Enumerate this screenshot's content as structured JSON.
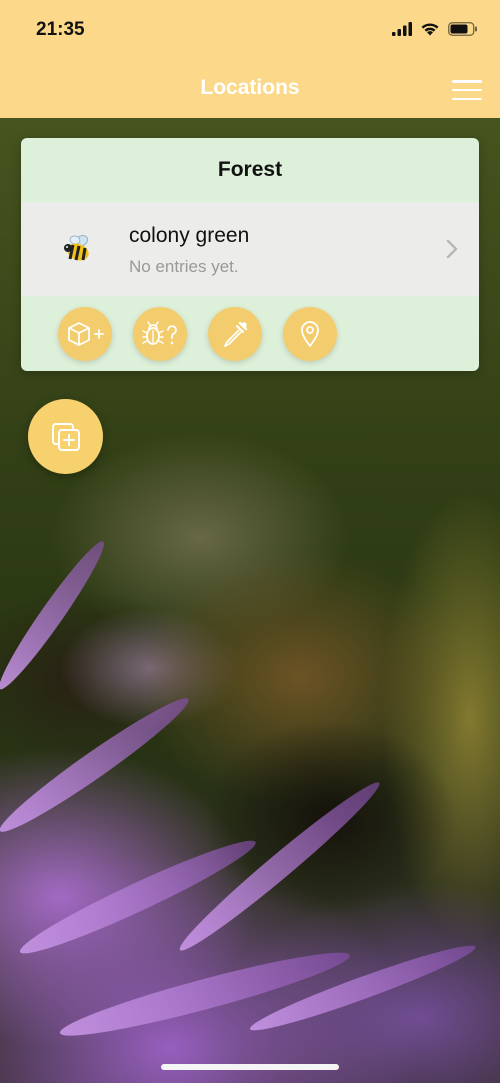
{
  "status_bar": {
    "time": "21:35",
    "icons": [
      "cellular-signal-icon",
      "wifi-icon",
      "battery-icon"
    ]
  },
  "nav": {
    "title": "Locations",
    "menu_icon": "hamburger-menu-icon"
  },
  "location_card": {
    "title": "Forest",
    "colony": {
      "icon": "bee-icon",
      "name": "colony green",
      "subtitle": "No entries yet."
    },
    "actions": [
      {
        "icon": "add-box-icon"
      },
      {
        "icon": "bug-question-icon"
      },
      {
        "icon": "pipette-icon"
      },
      {
        "icon": "location-pin-icon"
      }
    ]
  },
  "fab": {
    "icon": "add-copy-icon"
  },
  "colors": {
    "header": "#fcd98a",
    "title_text": "#ffffff",
    "card_bg": "#ddf0d9",
    "row_bg": "#ececea",
    "accent": "#f3cc6e"
  }
}
